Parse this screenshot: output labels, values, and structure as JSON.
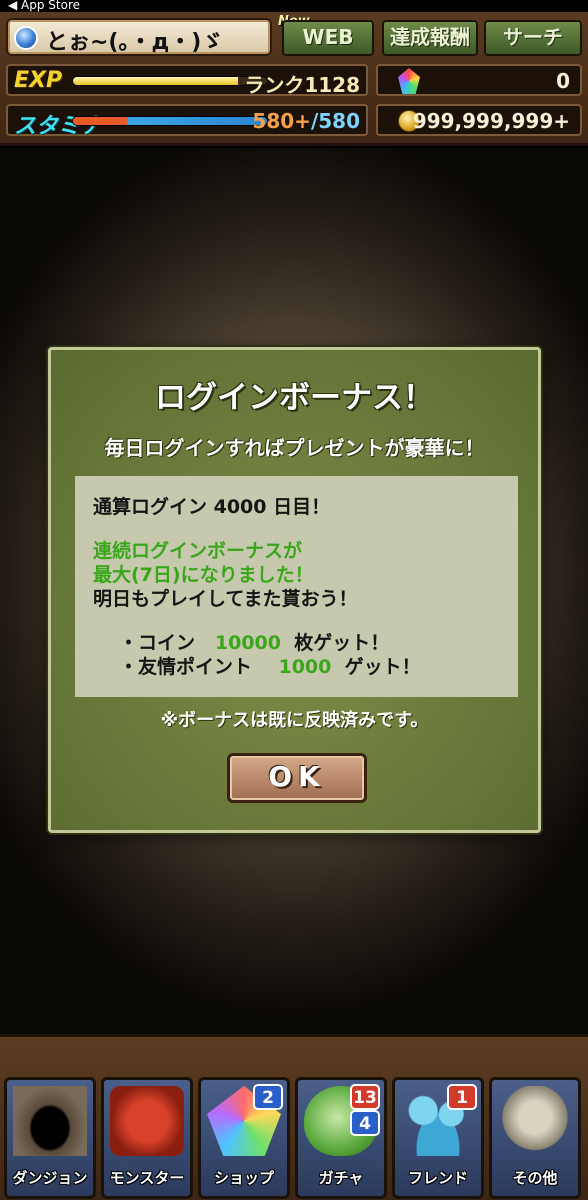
{
  "status_bar": {
    "back_label": "◀ App Store"
  },
  "header": {
    "player_name": "とぉ~(｡・д・)ゞ",
    "new_badge": "New",
    "web_label": "WEB",
    "achievements_label": "達成報酬",
    "search_label": "サーチ",
    "exp": {
      "label": "EXP",
      "rank_text": "ランク1128",
      "fill_fraction": 0.85
    },
    "stamina": {
      "label": "スタミナ",
      "current": "580+",
      "max": "/580",
      "fill_fraction": 1.0
    },
    "magic_stones": "0",
    "coins": "999,999,999+"
  },
  "dialog": {
    "title": "ログインボーナス！",
    "subtitle": "毎日ログインすればプレゼントが豪華に！",
    "total_login": "通算ログイン  4000  日目！",
    "streak_line1": "連続ログインボーナスが",
    "streak_line2": "最大(7日)になりました！",
    "tomorrow": "明日もプレイしてまた貰おう！",
    "reward_coin_prefix": "・コイン",
    "reward_coin_value": "10000",
    "reward_coin_suffix": "枚ゲット！",
    "reward_friend_prefix": "・友情ポイント",
    "reward_friend_value": "1000",
    "reward_friend_suffix": "ゲット！",
    "note": "※ボーナスは既に反映済みです。",
    "ok_label": "OK"
  },
  "nav": [
    {
      "label": "ダンジョン",
      "icon": "dungeon-icon"
    },
    {
      "label": "モンスター",
      "icon": "monster-icon"
    },
    {
      "label": "ショップ",
      "icon": "shop-icon",
      "badge": "2"
    },
    {
      "label": "ガチャ",
      "icon": "gacha-icon",
      "badge": "13",
      "badge2": "4"
    },
    {
      "label": "フレンド",
      "icon": "friend-icon",
      "badge": "1"
    },
    {
      "label": "その他",
      "icon": "other-icon"
    }
  ]
}
